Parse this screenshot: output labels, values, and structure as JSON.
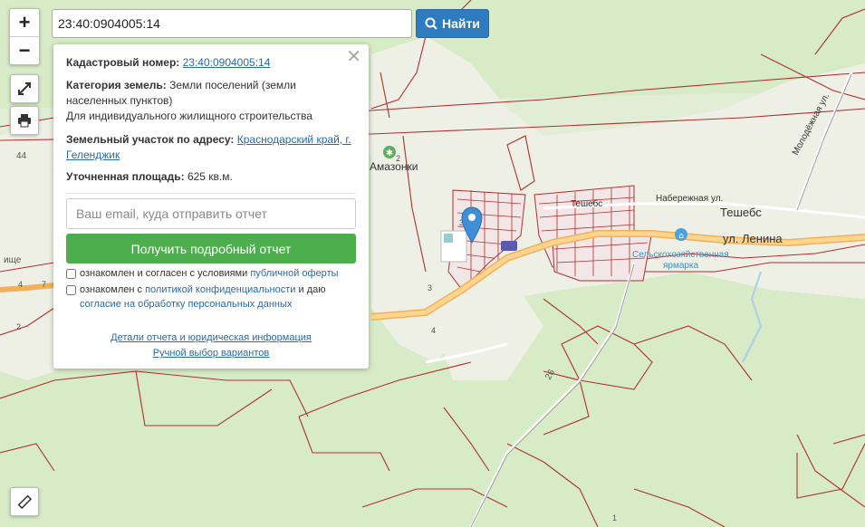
{
  "search": {
    "value": "23:40:0904005:14",
    "button_label": "Найти"
  },
  "map_controls": {
    "zoom_in": "+",
    "zoom_out": "−"
  },
  "map_labels": {
    "amazonki": "Амазонки",
    "tyeshebs_small": "Тешебс",
    "tyeshebs": "Тешебс",
    "naberezhnaya": "Набережная ул.",
    "molodezhnaya": "Молодёжная ул.",
    "lenina": "ул. Ленина",
    "fair_line1": "Сельскохозяйственная",
    "fair_line2": "ярмарка",
    "n44": "44",
    "n4a": "4",
    "n7": "7",
    "n2a": "2",
    "n4b": "4",
    "n3a": "3",
    "n3b": "3",
    "n2b": "2",
    "n26": "26",
    "n1": "1",
    "ische": "ище"
  },
  "card": {
    "cadastral_label": "Кадастровый номер:",
    "cadastral_value": "23:40:0904005:14",
    "category_label": "Категория земель:",
    "category_value": "Земли поселений (земли населенных пунктов)",
    "category_use": "Для индивидуального жилищного строительства",
    "address_label": "Земельный участок по адресу:",
    "address_value": "Краснодарский край, г. Геленджик",
    "area_label": "Уточненная площадь:",
    "area_value": "625 кв.м.",
    "email_placeholder": "Ваш email, куда отправить отчет",
    "report_button": "Получить подробный отчет",
    "consent1_text": "ознакомлен и согласен с условиями",
    "consent1_link": "публичной оферты",
    "consent2_text_a": "ознакомлен с",
    "consent2_link_a": "политикой конфиденциальности",
    "consent2_text_b": "и даю",
    "consent2_link_b": "согласие на обработку персональных данных",
    "details_link": "Детали отчета и юридическая информация",
    "manual_link": "Ручной выбор вариантов"
  }
}
